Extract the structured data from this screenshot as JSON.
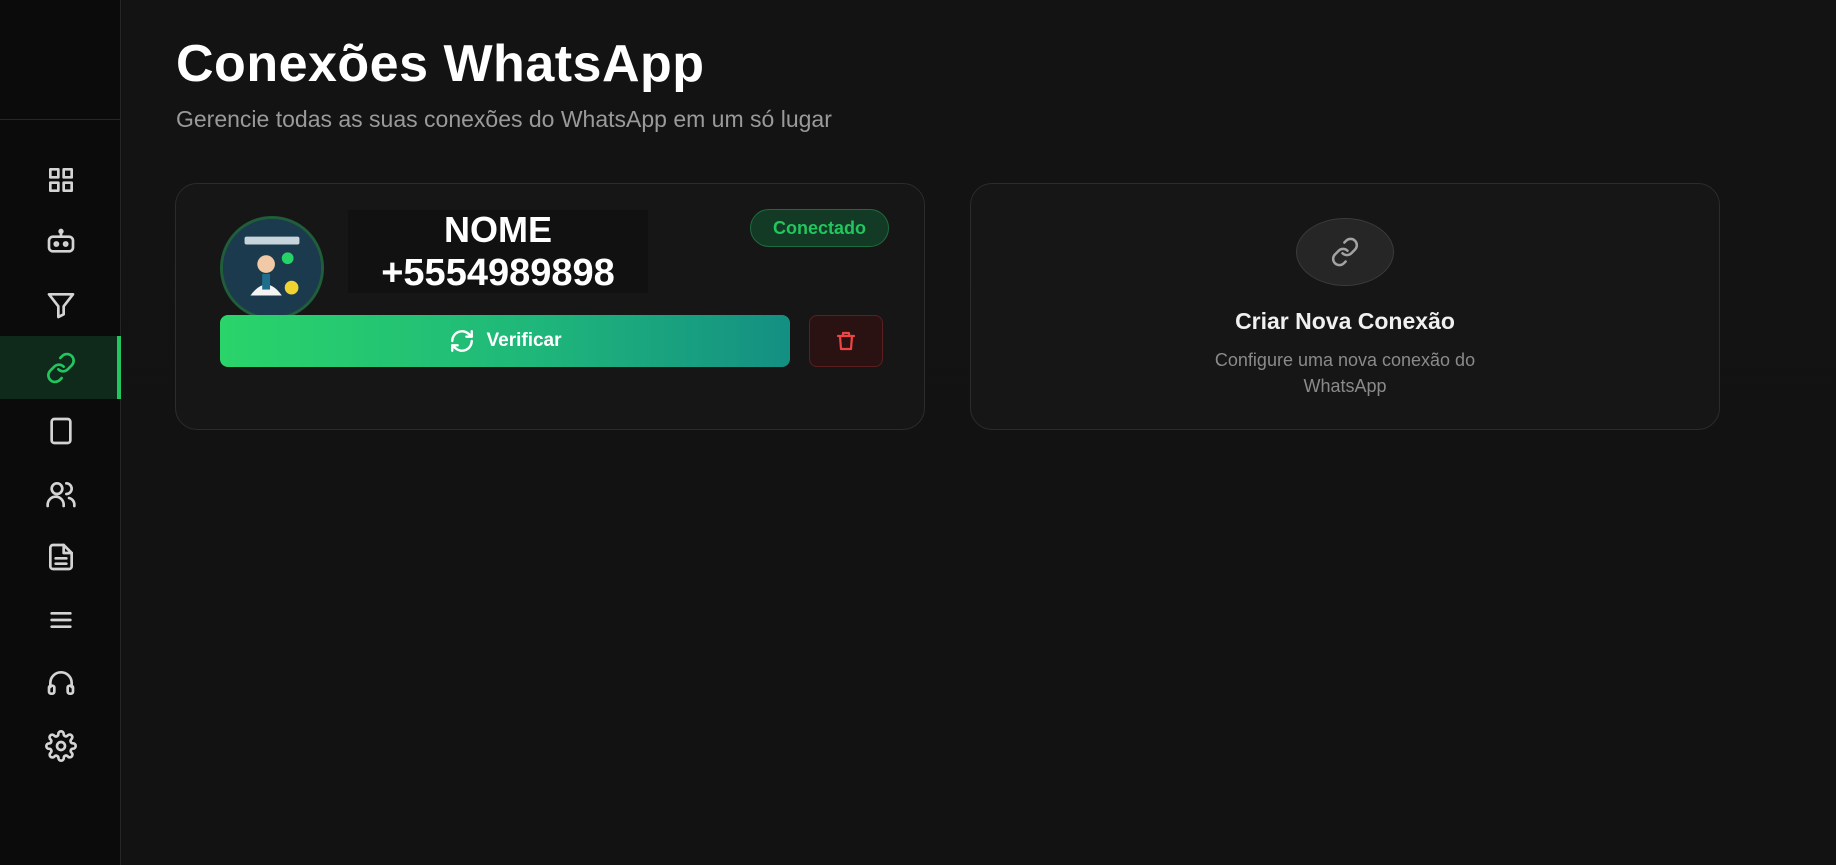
{
  "sidebar": {
    "items": [
      {
        "icon": "grid-icon",
        "active": false
      },
      {
        "icon": "bot-icon",
        "active": false
      },
      {
        "icon": "filter-icon",
        "active": false
      },
      {
        "icon": "link-icon",
        "active": true
      },
      {
        "icon": "square-icon",
        "active": false
      },
      {
        "icon": "users-icon",
        "active": false
      },
      {
        "icon": "document-icon",
        "active": false
      },
      {
        "icon": "menu-icon",
        "active": false
      },
      {
        "icon": "headset-icon",
        "active": false
      },
      {
        "icon": "gear-icon",
        "active": false
      }
    ],
    "accent_color": "#22c55e"
  },
  "header": {
    "title": "Conexões WhatsApp",
    "subtitle": "Gerencie todas as suas conexões do WhatsApp em um só lugar"
  },
  "connection": {
    "name": "NOME",
    "phone": "+5554989898",
    "status": "Conectado",
    "verify_label": "Verificar"
  },
  "new_connection": {
    "title": "Criar Nova Conexão",
    "description": "Configure uma nova conexão do WhatsApp"
  }
}
